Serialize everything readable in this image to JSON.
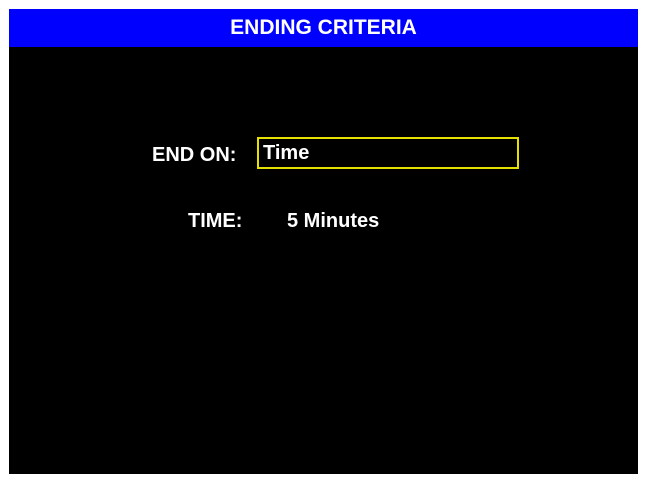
{
  "header": {
    "title": "ENDING CRITERIA"
  },
  "form": {
    "end_on": {
      "label": "END ON:",
      "value": "Time"
    },
    "time": {
      "label": "TIME:",
      "value": "5 Minutes"
    }
  },
  "colors": {
    "title_bar": "#0000ff",
    "background": "#000000",
    "text": "#ffffff",
    "selection_border": "#e6e000"
  }
}
